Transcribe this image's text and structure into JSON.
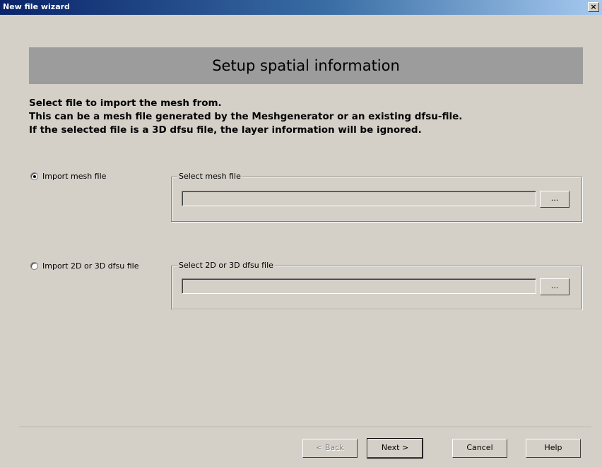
{
  "window": {
    "title": "New file wizard",
    "close_label": "×"
  },
  "header": {
    "title": "Setup spatial information"
  },
  "instructions": [
    "Select file to import the mesh from.",
    "This can be a mesh file generated by the Meshgenerator or an existing dfsu-file.",
    "If the selected file is a 3D dfsu file, the layer information will be ignored."
  ],
  "options": {
    "mesh": {
      "label": "Import mesh file",
      "selected": true,
      "group_label": "Select mesh file",
      "value": "",
      "browse_label": "..."
    },
    "dfsu": {
      "label": "Import 2D or 3D dfsu file",
      "selected": false,
      "group_label": "Select 2D or 3D dfsu file",
      "value": "",
      "browse_label": "..."
    }
  },
  "buttons": {
    "back": "< Back",
    "next": "Next >",
    "cancel": "Cancel",
    "help": "Help"
  }
}
